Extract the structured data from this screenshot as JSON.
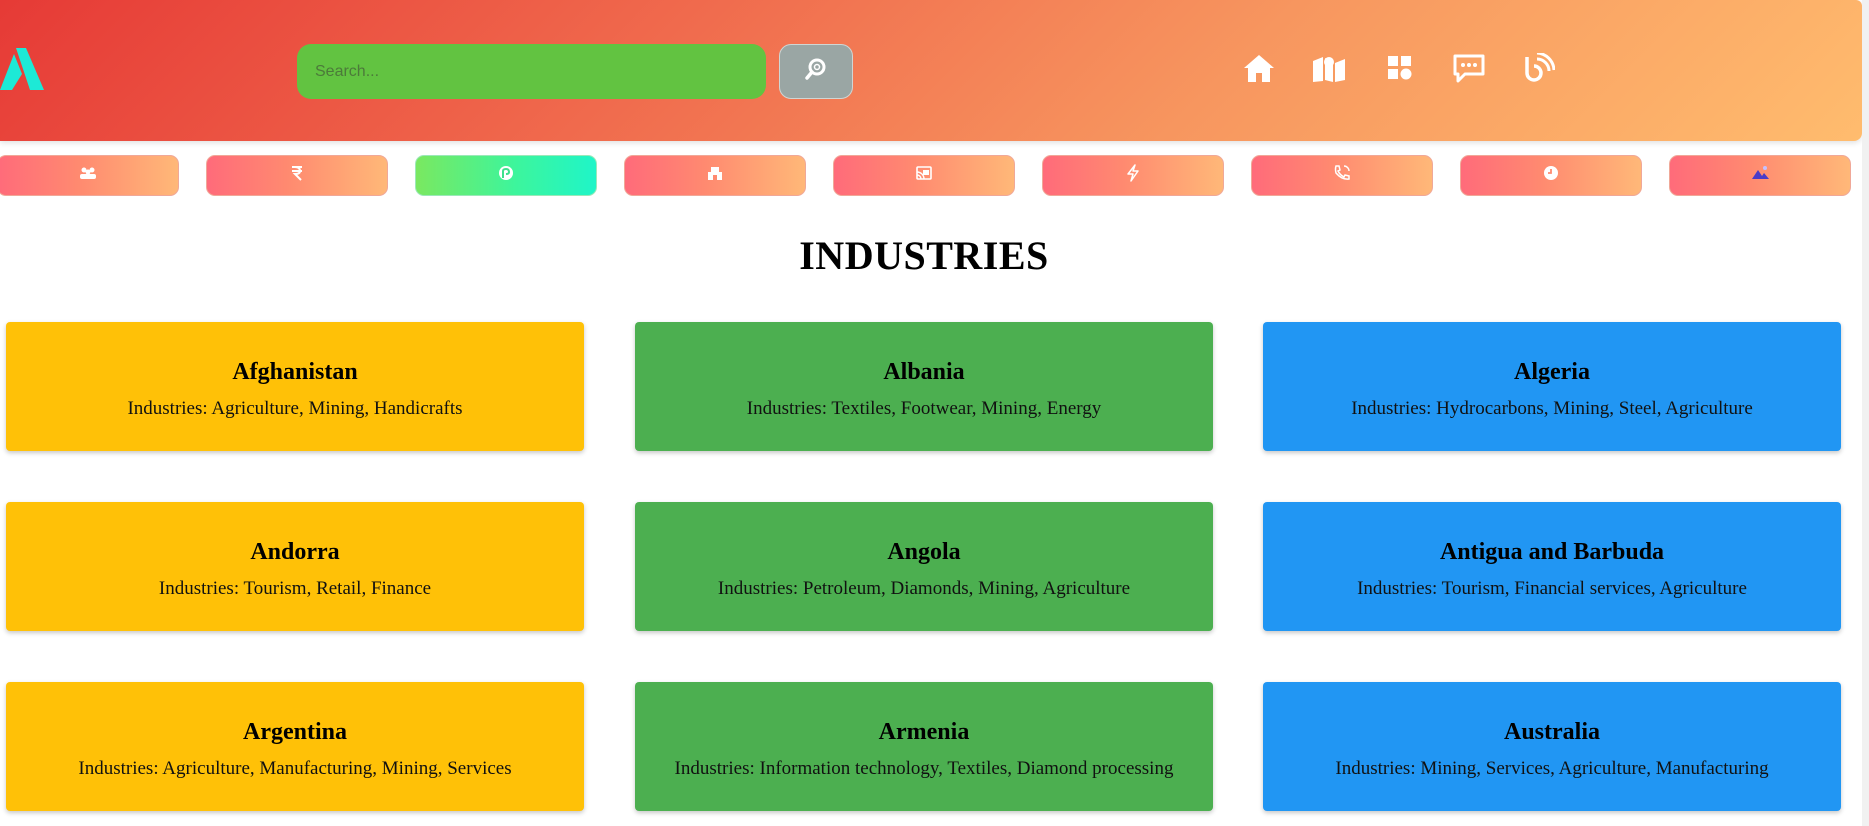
{
  "header": {
    "logo_icon": "triangle-logo",
    "search": {
      "placeholder": "Search...",
      "value": ""
    },
    "search_button_icon": "magnifier-icon",
    "nav_icons": [
      "home-icon",
      "map-icon",
      "dashboard-icon",
      "chat-icon",
      "blog-icon"
    ]
  },
  "category_bar": [
    {
      "icon": "group-icon",
      "active": false
    },
    {
      "icon": "rupee-icon",
      "active": false
    },
    {
      "icon": "reliance-icon",
      "active": true
    },
    {
      "icon": "castle-icon",
      "active": false
    },
    {
      "icon": "cast-icon",
      "active": false
    },
    {
      "icon": "bolt-icon",
      "active": false
    },
    {
      "icon": "phone-icon",
      "active": false
    },
    {
      "icon": "clock-icon",
      "active": false
    },
    {
      "icon": "mountain-icon",
      "active": false
    }
  ],
  "page": {
    "title": "INDUSTRIES"
  },
  "countries": [
    {
      "name": "Afghanistan",
      "industries": "Industries: Agriculture, Mining, Handicrafts"
    },
    {
      "name": "Albania",
      "industries": "Industries: Textiles, Footwear, Mining, Energy"
    },
    {
      "name": "Algeria",
      "industries": "Industries: Hydrocarbons, Mining, Steel, Agriculture"
    },
    {
      "name": "Andorra",
      "industries": "Industries: Tourism, Retail, Finance"
    },
    {
      "name": "Angola",
      "industries": "Industries: Petroleum, Diamonds, Mining, Agriculture"
    },
    {
      "name": "Antigua and Barbuda",
      "industries": "Industries: Tourism, Financial services, Agriculture"
    },
    {
      "name": "Argentina",
      "industries": "Industries: Agriculture, Manufacturing, Mining, Services"
    },
    {
      "name": "Armenia",
      "industries": "Industries: Information technology, Textiles, Diamond processing"
    },
    {
      "name": "Australia",
      "industries": "Industries: Mining, Services, Agriculture, Manufacturing"
    }
  ],
  "colors": {
    "column_1": "#ffc107",
    "column_2": "#4caf50",
    "column_3": "#2196f3",
    "accent_logo": "#1de9d6"
  }
}
